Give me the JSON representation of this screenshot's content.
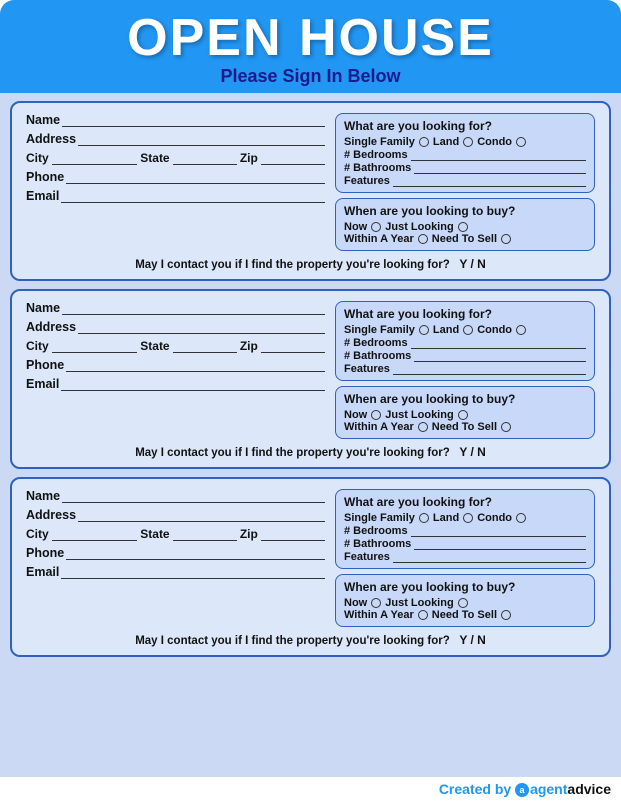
{
  "header": {
    "title": "OPEN HOUSE",
    "subtitle": "Please Sign In Below"
  },
  "form": {
    "fields": {
      "name": "Name",
      "address": "Address",
      "city": "City",
      "state": "State",
      "zip": "Zip",
      "phone": "Phone",
      "email": "Email"
    },
    "right_panel": {
      "looking_title": "What are you looking for?",
      "single_family": "Single Family",
      "land": "Land",
      "condo": "Condo",
      "bedrooms": "# Bedrooms",
      "bathrooms": "# Bathrooms",
      "features": "Features",
      "when_title": "When are you looking to buy?",
      "now": "Now",
      "just_looking": "Just Looking",
      "within_year": "Within A Year",
      "need_to_sell": "Need To Sell"
    },
    "contact_question": "May I contact you if I find the property you're looking for?",
    "yn": "Y / N"
  },
  "footer": {
    "created_by": "Created by",
    "agent": "agent",
    "advice": "advice"
  }
}
